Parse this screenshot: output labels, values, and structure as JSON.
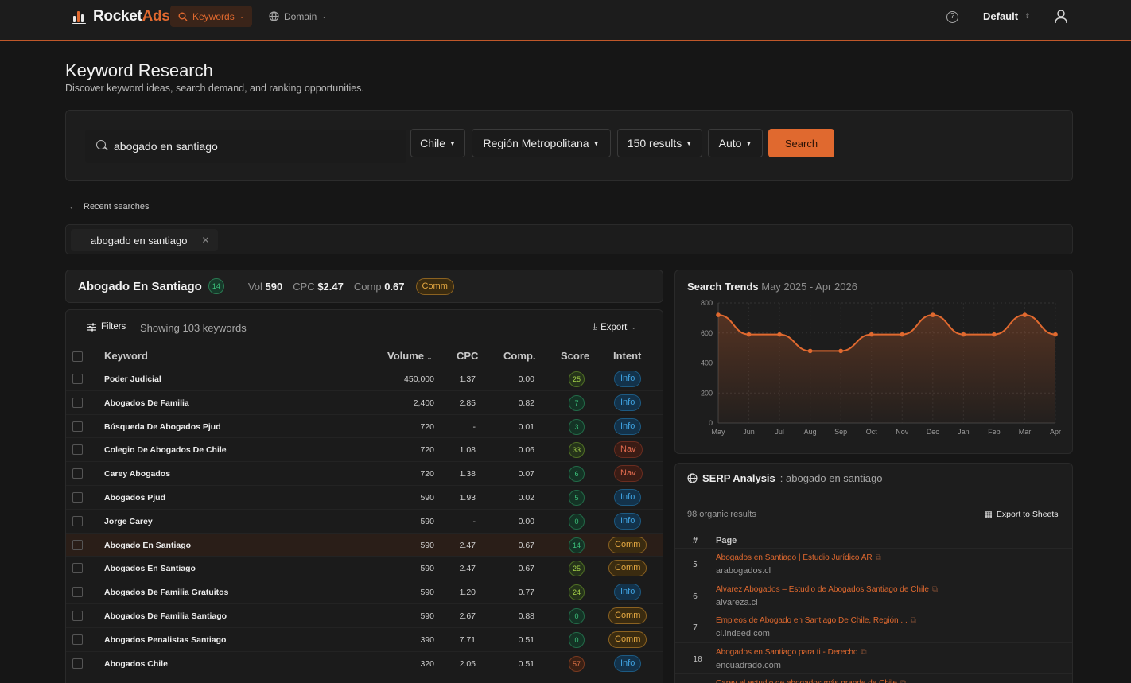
{
  "app": {
    "logo_main": "Rocket",
    "logo_accent": "Ads",
    "nav": [
      {
        "label": "Keywords"
      },
      {
        "label": "Domain"
      }
    ],
    "workspace": "Default"
  },
  "header": {
    "title": "Keyword Research",
    "subtitle": "Discover keyword ideas, search demand, and ranking opportunities."
  },
  "search": {
    "query": "abogado en santiago",
    "country": "Chile",
    "region": "Región Metropolitana",
    "results": "150 results",
    "mode": "Auto",
    "button": "Search"
  },
  "recent": {
    "label": "Recent searches",
    "items": [
      "abogado en santiago"
    ]
  },
  "summary": {
    "keyword": "Abogado En Santiago",
    "score": "14",
    "vol_label": "Vol",
    "vol": "590",
    "cpc_label": "CPC",
    "cpc": "$2.47",
    "comp_label": "Comp",
    "comp": "0.67",
    "intent": "Comm"
  },
  "table": {
    "filters_label": "Filters",
    "showing": "Showing 103 keywords",
    "export_label": "Export",
    "columns": {
      "keyword": "Keyword",
      "volume": "Volume",
      "cpc": "CPC",
      "comp": "Comp.",
      "score": "Score",
      "intent": "Intent"
    },
    "rows": [
      {
        "keyword": "Poder Judicial",
        "volume": "450,000",
        "cpc": "1.37",
        "comp": "0.00",
        "score": "25",
        "intent": "Info"
      },
      {
        "keyword": "Abogados De Familia",
        "volume": "2,400",
        "cpc": "2.85",
        "comp": "0.82",
        "score": "7",
        "intent": "Info"
      },
      {
        "keyword": "Búsqueda De Abogados Pjud",
        "volume": "720",
        "cpc": "-",
        "comp": "0.01",
        "score": "3",
        "intent": "Info"
      },
      {
        "keyword": "Colegio De Abogados De Chile",
        "volume": "720",
        "cpc": "1.08",
        "comp": "0.06",
        "score": "33",
        "intent": "Nav"
      },
      {
        "keyword": "Carey Abogados",
        "volume": "720",
        "cpc": "1.38",
        "comp": "0.07",
        "score": "6",
        "intent": "Nav"
      },
      {
        "keyword": "Abogados Pjud",
        "volume": "590",
        "cpc": "1.93",
        "comp": "0.02",
        "score": "5",
        "intent": "Info"
      },
      {
        "keyword": "Jorge Carey",
        "volume": "590",
        "cpc": "-",
        "comp": "0.00",
        "score": "0",
        "intent": "Info"
      },
      {
        "keyword": "Abogado En Santiago",
        "volume": "590",
        "cpc": "2.47",
        "comp": "0.67",
        "score": "14",
        "intent": "Comm"
      },
      {
        "keyword": "Abogados En Santiago",
        "volume": "590",
        "cpc": "2.47",
        "comp": "0.67",
        "score": "25",
        "intent": "Comm"
      },
      {
        "keyword": "Abogados De Familia Gratuitos",
        "volume": "590",
        "cpc": "1.20",
        "comp": "0.77",
        "score": "24",
        "intent": "Info"
      },
      {
        "keyword": "Abogados De Familia Santiago",
        "volume": "590",
        "cpc": "2.67",
        "comp": "0.88",
        "score": "0",
        "intent": "Comm"
      },
      {
        "keyword": "Abogados Penalistas Santiago",
        "volume": "390",
        "cpc": "7.71",
        "comp": "0.51",
        "score": "0",
        "intent": "Comm"
      },
      {
        "keyword": "Abogados Chile",
        "volume": "320",
        "cpc": "2.05",
        "comp": "0.51",
        "score": "57",
        "intent": "Info"
      }
    ]
  },
  "trends": {
    "title": "Search Trends",
    "range": "May 2025 - Apr 2026"
  },
  "chart_data": {
    "type": "area",
    "title": "Search Trends",
    "subtitle": "May 2025 - Apr 2026",
    "categories": [
      "May",
      "Jun",
      "Jul",
      "Aug",
      "Sep",
      "Oct",
      "Nov",
      "Dec",
      "Jan",
      "Feb",
      "Mar",
      "Apr"
    ],
    "values": [
      720,
      590,
      590,
      480,
      480,
      590,
      590,
      720,
      590,
      590,
      720,
      590
    ],
    "ylim": [
      0,
      800
    ],
    "yticks": [
      0,
      200,
      400,
      600,
      800
    ],
    "grid": true,
    "color": "#e0692f"
  },
  "serp": {
    "title": "SERP Analysis",
    "query": ": abogado en santiago",
    "count": "98 organic results",
    "export_label": "Export to Sheets",
    "col_num": "#",
    "col_page": "Page",
    "rows": [
      {
        "rank": "5",
        "title": "Abogados en Santiago | Estudio Jurídico AR",
        "domain": "arabogados.cl"
      },
      {
        "rank": "6",
        "title": "Alvarez Abogados – Estudio de Abogados Santiago de Chile",
        "domain": "alvareza.cl"
      },
      {
        "rank": "7",
        "title": "Empleos de Abogado en Santiago De Chile, Región ...",
        "domain": "cl.indeed.com"
      },
      {
        "rank": "10",
        "title": "Abogados en Santiago para ti - Derecho",
        "domain": "encuadrado.com"
      },
      {
        "rank": "",
        "title": "Carey el estudio de abogados más grande de Chile",
        "domain": ""
      }
    ]
  },
  "colors": {
    "accent": "#e0692f",
    "background": "#161616",
    "info": "#3fa2e0",
    "nav": "#e26b4f",
    "comm": "#e4a842",
    "score_green": "#3cc07a"
  }
}
